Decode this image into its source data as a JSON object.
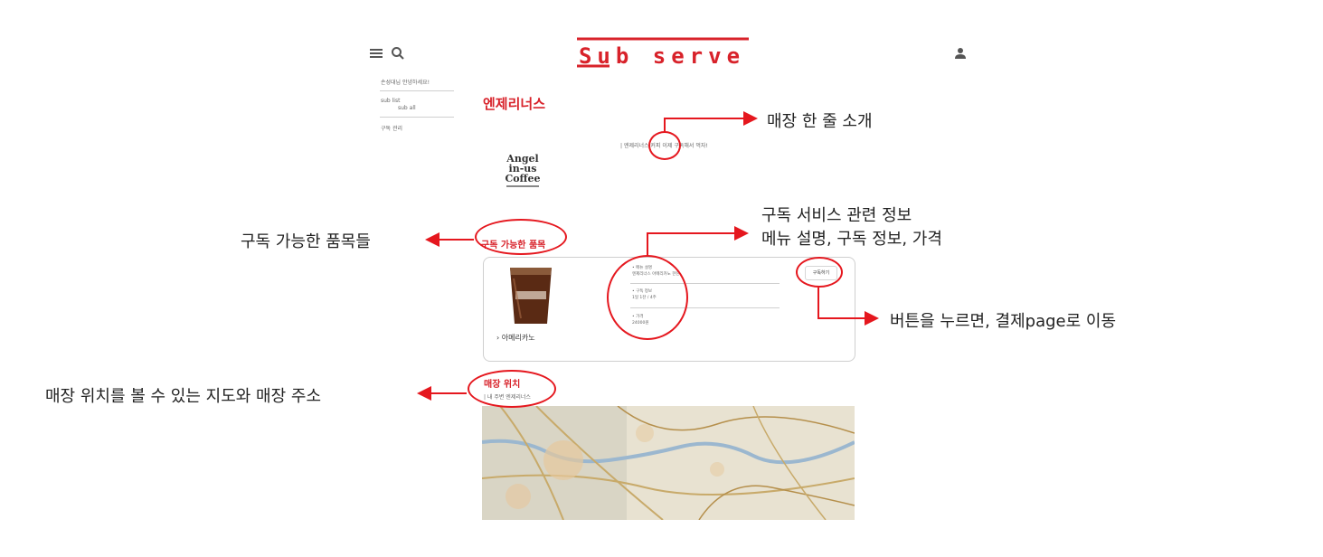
{
  "header": {
    "logo_text": "Sub serve",
    "menu_icon": "hamburger-menu-icon",
    "search_icon": "search-icon",
    "user_icon": "user-icon"
  },
  "sidebar": {
    "greeting": "손성대님 안녕하세요!",
    "sub_list_label": "sub list",
    "sub_list_item": "sub all",
    "subscription_management": "구독 관리"
  },
  "store": {
    "name": "엔제리너스",
    "intro": "| 엔제리너스 커피 이제 구독해서 먹자!",
    "brand_logo_lines": [
      "Angel",
      "in-us",
      "Coffee"
    ]
  },
  "products": {
    "section_title": "구독 가능한 품목",
    "item": {
      "name": "아메리카노",
      "menu_label": "• 메뉴 설명",
      "menu_desc": "엔제리너스 아메리카노 한잔",
      "sub_label": "• 구독 정보",
      "sub_desc": "1일 1잔 / 4주",
      "price_label": "• 가격",
      "price": "24000원",
      "subscribe_button": "구독하기"
    }
  },
  "location": {
    "section_title": "매장 위치",
    "address": "| 내 주변 엔제리너스"
  },
  "annotations": {
    "intro_note": "매장 한 줄 소개",
    "service_note_line1": "구독 서비스 관련 정보",
    "service_note_line2": "메뉴 설명, 구독 정보, 가격",
    "button_note": "버튼을 누르면, 결제page로 이동",
    "items_note": "구독 가능한 품목들",
    "map_note": "매장 위치를 볼 수 있는 지도와 매장 주소"
  },
  "colors": {
    "brand_red": "#d8222a",
    "annotation_red": "#e5171e"
  }
}
